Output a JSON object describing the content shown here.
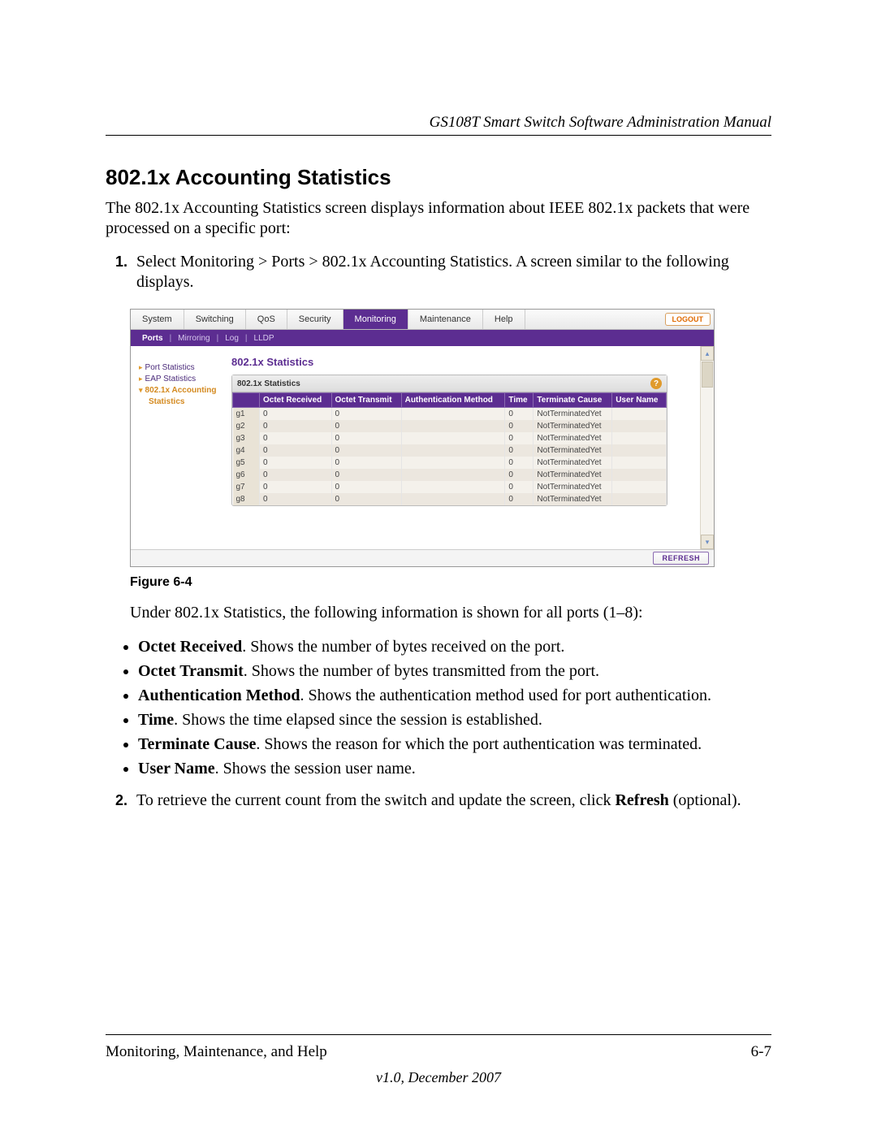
{
  "doc_header": "GS108T Smart Switch Software Administration Manual",
  "section_title": "802.1x Accounting Statistics",
  "intro_text": "The 802.1x Accounting Statistics screen displays information about IEEE 802.1x packets that were processed on a specific port:",
  "step1_text": "Select Monitoring > Ports > 802.1x Accounting Statistics. A screen similar to the following displays.",
  "figure_caption": "Figure 6-4",
  "under_text": "Under 802.1x Statistics, the following information is shown for all ports (1–8):",
  "bullets": [
    {
      "term": "Octet Received",
      "desc": ". Shows the number of bytes received on the port."
    },
    {
      "term": "Octet Transmit",
      "desc": ". Shows the number of bytes transmitted from the port."
    },
    {
      "term": "Authentication Method",
      "desc": ". Shows the authentication method used for port authentication."
    },
    {
      "term": "Time",
      "desc": ". Shows the time elapsed since the session is established."
    },
    {
      "term": "Terminate Cause",
      "desc": ". Shows the reason for which the port authentication was terminated."
    },
    {
      "term": "User Name",
      "desc": ". Shows the session user name."
    }
  ],
  "step2_prefix": "To retrieve the current count from the switch and update the screen, click ",
  "step2_bold": "Refresh",
  "step2_suffix": " (optional).",
  "footer_left": "Monitoring, Maintenance, and Help",
  "footer_right": "6-7",
  "footer_version": "v1.0, December 2007",
  "app": {
    "top_tabs": [
      "System",
      "Switching",
      "QoS",
      "Security",
      "Monitoring",
      "Maintenance",
      "Help"
    ],
    "top_active_index": 4,
    "logout": "LOGOUT",
    "sub_tabs": [
      "Ports",
      "Mirroring",
      "Log",
      "LLDP"
    ],
    "sub_active_index": 0,
    "sidebar": {
      "port_stats": "Port Statistics",
      "eap_stats": "EAP Statistics",
      "acct_stats": "802.1x Accounting",
      "acct_stats_sub": "Statistics"
    },
    "panel_title": "802.1x Statistics",
    "panel_header": "802.1x Statistics",
    "columns": [
      "",
      "Octet Received",
      "Octet Transmit",
      "Authentication Method",
      "Time",
      "Terminate Cause",
      "User Name"
    ],
    "rows": [
      {
        "port": "g1",
        "or": "0",
        "ot": "0",
        "am": "",
        "time": "0",
        "tc": "NotTerminatedYet",
        "un": ""
      },
      {
        "port": "g2",
        "or": "0",
        "ot": "0",
        "am": "",
        "time": "0",
        "tc": "NotTerminatedYet",
        "un": ""
      },
      {
        "port": "g3",
        "or": "0",
        "ot": "0",
        "am": "",
        "time": "0",
        "tc": "NotTerminatedYet",
        "un": ""
      },
      {
        "port": "g4",
        "or": "0",
        "ot": "0",
        "am": "",
        "time": "0",
        "tc": "NotTerminatedYet",
        "un": ""
      },
      {
        "port": "g5",
        "or": "0",
        "ot": "0",
        "am": "",
        "time": "0",
        "tc": "NotTerminatedYet",
        "un": ""
      },
      {
        "port": "g6",
        "or": "0",
        "ot": "0",
        "am": "",
        "time": "0",
        "tc": "NotTerminatedYet",
        "un": ""
      },
      {
        "port": "g7",
        "or": "0",
        "ot": "0",
        "am": "",
        "time": "0",
        "tc": "NotTerminatedYet",
        "un": ""
      },
      {
        "port": "g8",
        "or": "0",
        "ot": "0",
        "am": "",
        "time": "0",
        "tc": "NotTerminatedYet",
        "un": ""
      }
    ],
    "refresh_label": "REFRESH",
    "help": "?"
  }
}
